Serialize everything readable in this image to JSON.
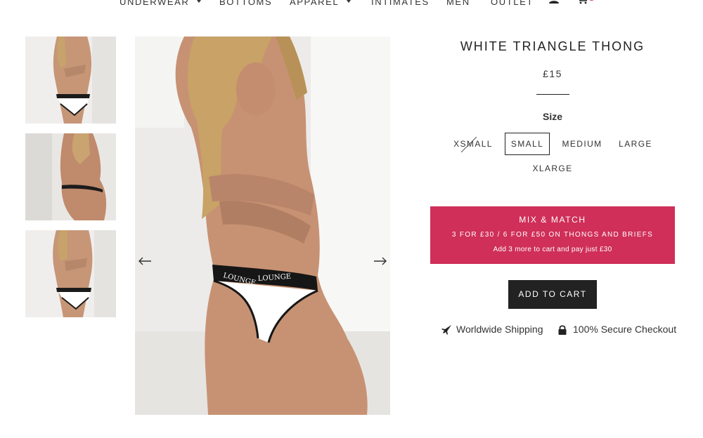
{
  "nav": {
    "items": [
      {
        "label": "UNDERWEAR",
        "dropdown": true
      },
      {
        "label": "BOTTOMS",
        "dropdown": false
      },
      {
        "label": "APPAREL",
        "dropdown": true
      },
      {
        "label": "INTIMATES",
        "dropdown": false
      },
      {
        "label": "MEN",
        "dropdown": false
      },
      {
        "label": "OUTLET",
        "dropdown": false
      }
    ],
    "icons": [
      "account-icon",
      "cart-icon"
    ]
  },
  "gallery": {
    "thumbnails": [
      "front-view",
      "back-view",
      "front-view"
    ],
    "prev_arrow": "←",
    "next_arrow": "→"
  },
  "product": {
    "title": "WHITE TRIANGLE THONG",
    "price": "£15",
    "size_label": "Size",
    "sizes": [
      {
        "label": "XSMALL",
        "available": false,
        "selected": false
      },
      {
        "label": "SMALL",
        "available": true,
        "selected": true
      },
      {
        "label": "MEDIUM",
        "available": true,
        "selected": false
      },
      {
        "label": "LARGE",
        "available": true,
        "selected": false
      },
      {
        "label": "XLARGE",
        "available": true,
        "selected": false
      }
    ],
    "promo": {
      "title": "MIX & MATCH",
      "offer": "3 FOR £30 / 6 FOR £50 ON THONGS AND BRIEFS",
      "note": "Add 3 more to cart and pay just £30"
    },
    "add_to_cart": "ADD TO CART",
    "features": [
      {
        "icon": "plane-icon",
        "label": "Worldwide Shipping"
      },
      {
        "icon": "lock-icon",
        "label": "100% Secure Checkout"
      }
    ]
  },
  "colors": {
    "promo_bg": "#cf2f58",
    "button_bg": "#222222",
    "cart_badge": "#d63a5a"
  }
}
